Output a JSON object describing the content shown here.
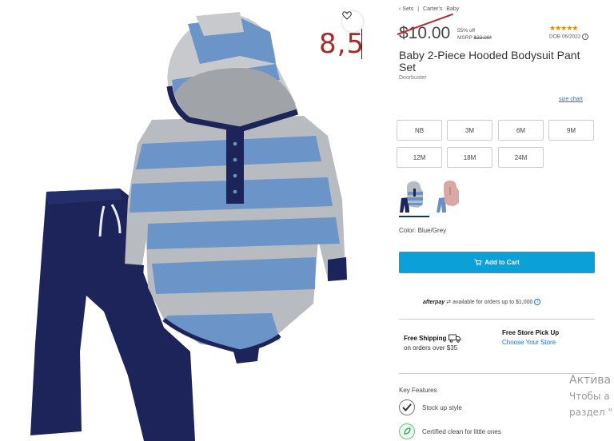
{
  "breadcrumb": [
    "‹ Sets",
    "|",
    "Carter's",
    "Baby"
  ],
  "price": {
    "current": "$10.00",
    "discount_pct": "55% off",
    "msrp_label": "MSRP",
    "msrp_value": "$22.00*"
  },
  "rating": {
    "stars": 4.5,
    "stars_glyphs": "★★★★★"
  },
  "dob_label": "DOB 06/2022",
  "product": {
    "title": "Baby 2-Piece Hooded Bodysuit Pant Set",
    "subtitle": "Doorbuster"
  },
  "size_chart_label": "size chart",
  "sizes": [
    "NB",
    "3M",
    "6M",
    "9M",
    "12M",
    "18M",
    "24M"
  ],
  "swatches": [
    {
      "name": "Blue/Grey",
      "selected": true,
      "color": "#5b86bd"
    },
    {
      "name": "Pink/Blue",
      "selected": false,
      "color": "#d8a8a2"
    }
  ],
  "color_label": "Color: Blue/Grey",
  "add_to_cart_label": "Add to Cart",
  "afterpay": {
    "brand": "afterpay",
    "text": "available for orders up to $1,000"
  },
  "shipping": {
    "title": "Free Shipping",
    "subtitle": "on orders over $35"
  },
  "pickup": {
    "title": "Free Store Pick Up",
    "link": "Choose Your Store"
  },
  "key_features_title": "Key Features",
  "features": [
    {
      "icon": "check-circle-icon",
      "label": "Stock up style"
    },
    {
      "icon": "leaf-shield-icon",
      "label": "Certified clean for little ones"
    }
  ],
  "overlay_annotation": "8,5",
  "windows_watermark": {
    "line1": "Актива",
    "line2": "Чтобы а",
    "line3": "раздел \""
  },
  "colors": {
    "accent": "#0ba0d8",
    "link": "#1a73c8",
    "star": "#e08a00",
    "strike": "#c0262e"
  }
}
